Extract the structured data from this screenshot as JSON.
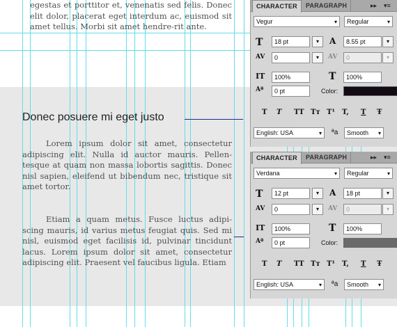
{
  "document": {
    "para_top": "egestas et porttitor et, venenatis sed felis. Donec elit dolor, placerat eget interdum ac, euismod sit amet tellus. Morbi sit amet hendre-rit ante.",
    "heading": "Donec posuere mi eget justo",
    "para_1": "Lorem ipsum dolor sit amet, consectetur adipiscing elit. Nulla id auctor mauris. Pellen-tesque at quam non massa lobortis sagittis. Donec nisl sapien, eleifend ut bibendum nec, tristique sit amet tortor.",
    "para_2": "Etiam a quam metus. Fusce luctus adipi-scing mauris, id varius metus feugiat quis. Sed mi nisl, euismod eget facilisis id, pulvinar tincidunt lacus. Lorem ipsum dolor sit amet, consectetur adipiscing elit. Praesent vel faucibus ligula. Etiam"
  },
  "panels": [
    {
      "tab_character": "CHARACTER",
      "tab_paragraph": "PARAGRAPH",
      "menu_glyph": "▸▸",
      "options_glyph": "▾≡",
      "font_family": "Vegur",
      "font_style": "Regular",
      "font_size": "18 pt",
      "leading": "8.55 pt",
      "kerning": "0",
      "tracking": "0",
      "vertical_scale": "100%",
      "horizontal_scale": "100%",
      "baseline_shift": "0 pt",
      "color_label": "Color:",
      "color": "#140a14",
      "language": "English: USA",
      "antialias": "Smooth",
      "antialias_icon": "ªa"
    },
    {
      "tab_character": "CHARACTER",
      "tab_paragraph": "PARAGRAPH",
      "menu_glyph": "▸▸",
      "options_glyph": "▾≡",
      "font_family": "Verdana",
      "font_style": "Regular",
      "font_size": "12 pt",
      "leading": "18 pt",
      "kerning": "0",
      "tracking": "0",
      "vertical_scale": "100%",
      "horizontal_scale": "100%",
      "baseline_shift": "0 pt",
      "color_label": "Color:",
      "color": "#6a6a6a",
      "language": "English: USA",
      "antialias": "Smooth",
      "antialias_icon": "ªa"
    }
  ],
  "style_buttons": [
    "T",
    "T",
    "TT",
    "Tт",
    "T¹",
    "T,",
    "T",
    "Ŧ"
  ],
  "icons": {
    "dropdown": "▾",
    "font_size": "T",
    "leading": "A",
    "kerning": "AV",
    "tracking": "AV",
    "vertical_scale": "IT",
    "horizontal_scale": "T",
    "baseline_shift": "Aª"
  }
}
